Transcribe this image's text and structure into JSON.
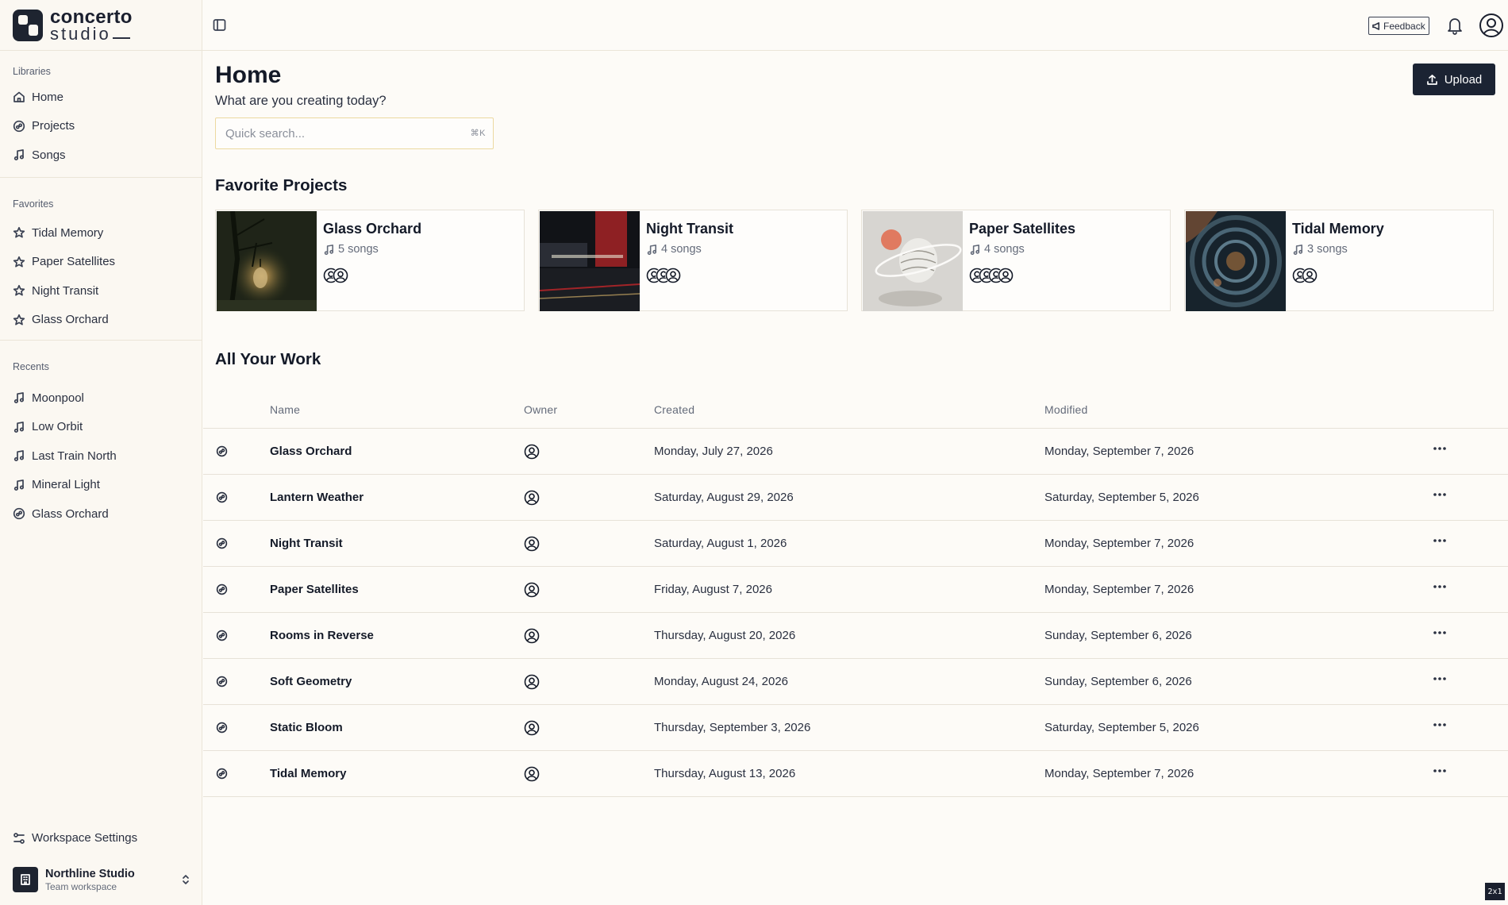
{
  "brand": {
    "name": "concerto",
    "sub": "studio"
  },
  "sidebar": {
    "libraries_label": "Libraries",
    "libraries": [
      {
        "label": "Home",
        "icon": "home-icon"
      },
      {
        "label": "Projects",
        "icon": "project-icon"
      },
      {
        "label": "Songs",
        "icon": "music-note-icon"
      }
    ],
    "favorites_label": "Favorites",
    "favorites": [
      {
        "label": "Tidal Memory",
        "icon": "star-icon"
      },
      {
        "label": "Paper Satellites",
        "icon": "star-icon"
      },
      {
        "label": "Night Transit",
        "icon": "star-icon"
      },
      {
        "label": "Glass Orchard",
        "icon": "star-icon"
      }
    ],
    "recents_label": "Recents",
    "recents": [
      {
        "label": "Moonpool",
        "icon": "music-note-icon"
      },
      {
        "label": "Low Orbit",
        "icon": "music-note-icon"
      },
      {
        "label": "Last Train North",
        "icon": "music-note-icon"
      },
      {
        "label": "Mineral Light",
        "icon": "music-note-icon"
      },
      {
        "label": "Glass Orchard",
        "icon": "project-icon"
      }
    ],
    "settings_label": "Workspace Settings",
    "workspace": {
      "name": "Northline Studio",
      "type": "Team workspace"
    }
  },
  "topbar": {
    "feedback_label": "Feedback"
  },
  "main": {
    "title": "Home",
    "subtitle": "What are you creating today?",
    "upload_label": "Upload",
    "search": {
      "placeholder": "Quick search...",
      "shortcut": "⌘K"
    },
    "favorites_title": "Favorite Projects",
    "favorite_projects": [
      {
        "title": "Glass Orchard",
        "songs": "5 songs",
        "collaborators": 2
      },
      {
        "title": "Night Transit",
        "songs": "4 songs",
        "collaborators": 3
      },
      {
        "title": "Paper Satellites",
        "songs": "4 songs",
        "collaborators": 4
      },
      {
        "title": "Tidal Memory",
        "songs": "3 songs",
        "collaborators": 2
      }
    ],
    "work_title": "All Your Work",
    "columns": {
      "name": "Name",
      "owner": "Owner",
      "created": "Created",
      "modified": "Modified"
    },
    "rows": [
      {
        "name": "Glass Orchard",
        "created": "Monday, July 27, 2026",
        "modified": "Monday, September 7, 2026"
      },
      {
        "name": "Lantern Weather",
        "created": "Saturday, August 29, 2026",
        "modified": "Saturday, September 5, 2026"
      },
      {
        "name": "Night Transit",
        "created": "Saturday, August 1, 2026",
        "modified": "Monday, September 7, 2026"
      },
      {
        "name": "Paper Satellites",
        "created": "Friday, August 7, 2026",
        "modified": "Monday, September 7, 2026"
      },
      {
        "name": "Rooms in Reverse",
        "created": "Thursday, August 20, 2026",
        "modified": "Sunday, September 6, 2026"
      },
      {
        "name": "Soft Geometry",
        "created": "Monday, August 24, 2026",
        "modified": "Sunday, September 6, 2026"
      },
      {
        "name": "Static Bloom",
        "created": "Thursday, September 3, 2026",
        "modified": "Saturday, September 5, 2026"
      },
      {
        "name": "Tidal Memory",
        "created": "Thursday, August 13, 2026",
        "modified": "Monday, September 7, 2026"
      }
    ]
  },
  "zoom_badge": "2x1",
  "colors": {
    "background": "#fdfbf7",
    "primary": "#1b2333",
    "border": "#ebe5d8",
    "search_border": "#ecd9a0"
  }
}
